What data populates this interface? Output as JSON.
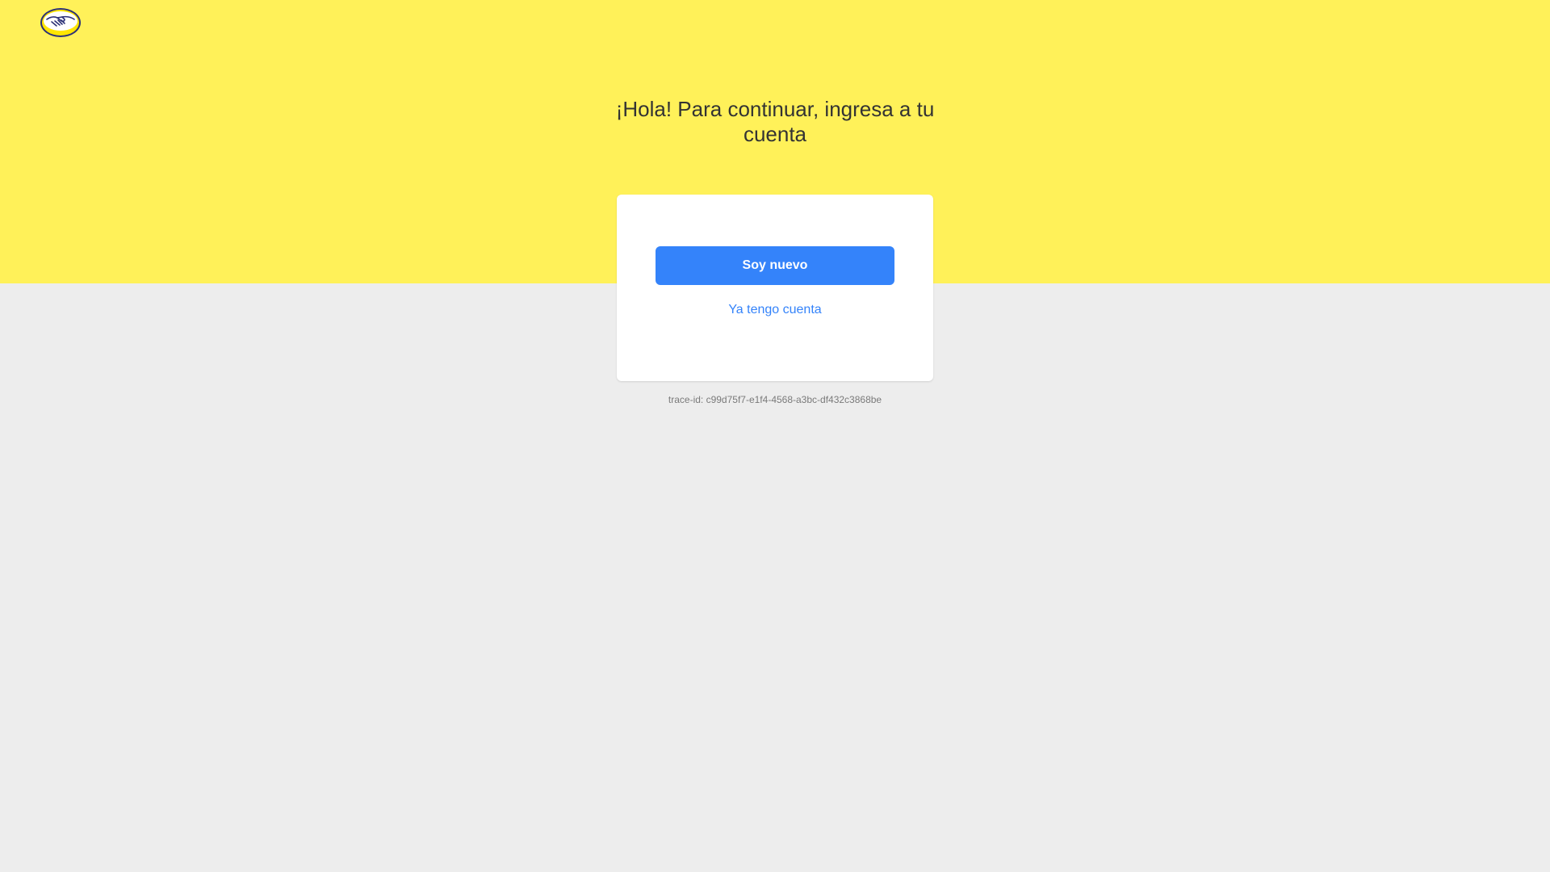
{
  "header": {
    "logo_icon": "mercadolibre-handshake-logo-icon",
    "background_color": "#fff159"
  },
  "main": {
    "title": "¡Hola! Para continuar, ingresa a tu cuenta",
    "primary_button_label": "Soy nuevo",
    "secondary_link_label": "Ya tengo cuenta",
    "accent_color": "#3483fa"
  },
  "footer": {
    "trace_id": "trace-id: c99d75f7-e1f4-4568-a3bc-df432c3868be"
  }
}
